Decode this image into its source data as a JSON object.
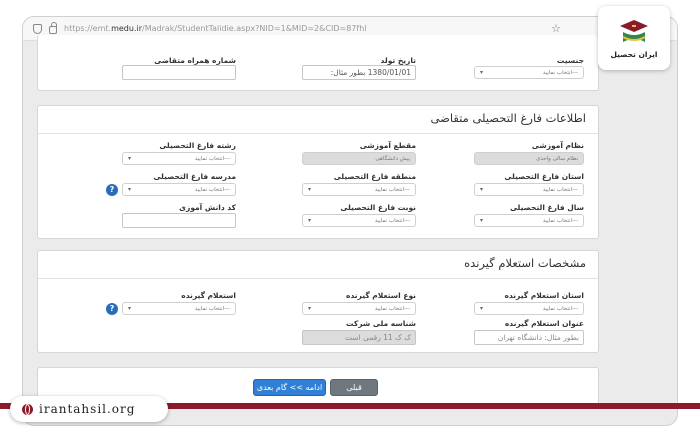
{
  "browser": {
    "url_prefix": "https://emt.",
    "url_domain": "medu.ir",
    "url_rest": "/Madrak/StudentTalidie.aspx?NID=1&MID=2&CID=87fhl"
  },
  "top_section": {
    "gender": {
      "label": "جنسیت",
      "value": "---انتخاب نمایید"
    },
    "birthdate": {
      "label": "تاریخ تولد",
      "value": "1380/01/01 بطور مثال:"
    },
    "companion_phone": {
      "label": "شماره همراه متقاضی",
      "value": ""
    }
  },
  "graduate_info": {
    "title": "اطلاعات فارغ التحصیلی متقاضی",
    "education_system": {
      "label": "نظام آموزشی",
      "value": "نظام سالی واحدی"
    },
    "education_level": {
      "label": "مقطع آموزشی",
      "value": "پیش دانشگاهی"
    },
    "field": {
      "label": "رشته فارغ التحصیلی",
      "value": "---انتخاب نمایید"
    },
    "province": {
      "label": "استان فارغ التحصیلی",
      "value": "---انتخاب نمایید"
    },
    "region": {
      "label": "منطقه فارغ التحصیلی",
      "value": "---انتخاب نمایید"
    },
    "school": {
      "label": "مدرسه فارغ التحصیلی",
      "value": "---انتخاب نمایید"
    },
    "year": {
      "label": "سال فارغ التحصیلی",
      "value": "---انتخاب نمایید"
    },
    "term": {
      "label": "نوبت فارغ التحصیلی",
      "value": "---انتخاب نمایید"
    },
    "student_code": {
      "label": "کد دانش آموزی",
      "value": ""
    }
  },
  "inquirer_info": {
    "title": "مشخصات استعلام گیرنده",
    "province": {
      "label": "استان استعلام گیرنده",
      "value": "---انتخاب نمایید"
    },
    "type": {
      "label": "نوع استعلام گیرنده",
      "value": "---انتخاب نمایید"
    },
    "inquirer": {
      "label": "استعلام گیرنده",
      "value": "---انتخاب نمایید"
    },
    "title_field": {
      "label": "عنوان استعلام گیرنده",
      "placeholder": "بطور مثال: دانشگاه تهران"
    },
    "national_id": {
      "label": "شناسه ملی شرکت",
      "placeholder": "ک ک 11 رقمی است"
    }
  },
  "actions": {
    "next": "ادامه >> گام بعدی",
    "prev": "قبلی"
  },
  "branding": {
    "logo_text": "ایران تحصیل",
    "site": "irantahsil.org"
  },
  "colors": {
    "accent": "#2f80d6",
    "brand": "#8b1a2a",
    "help": "#2b6cb8"
  }
}
